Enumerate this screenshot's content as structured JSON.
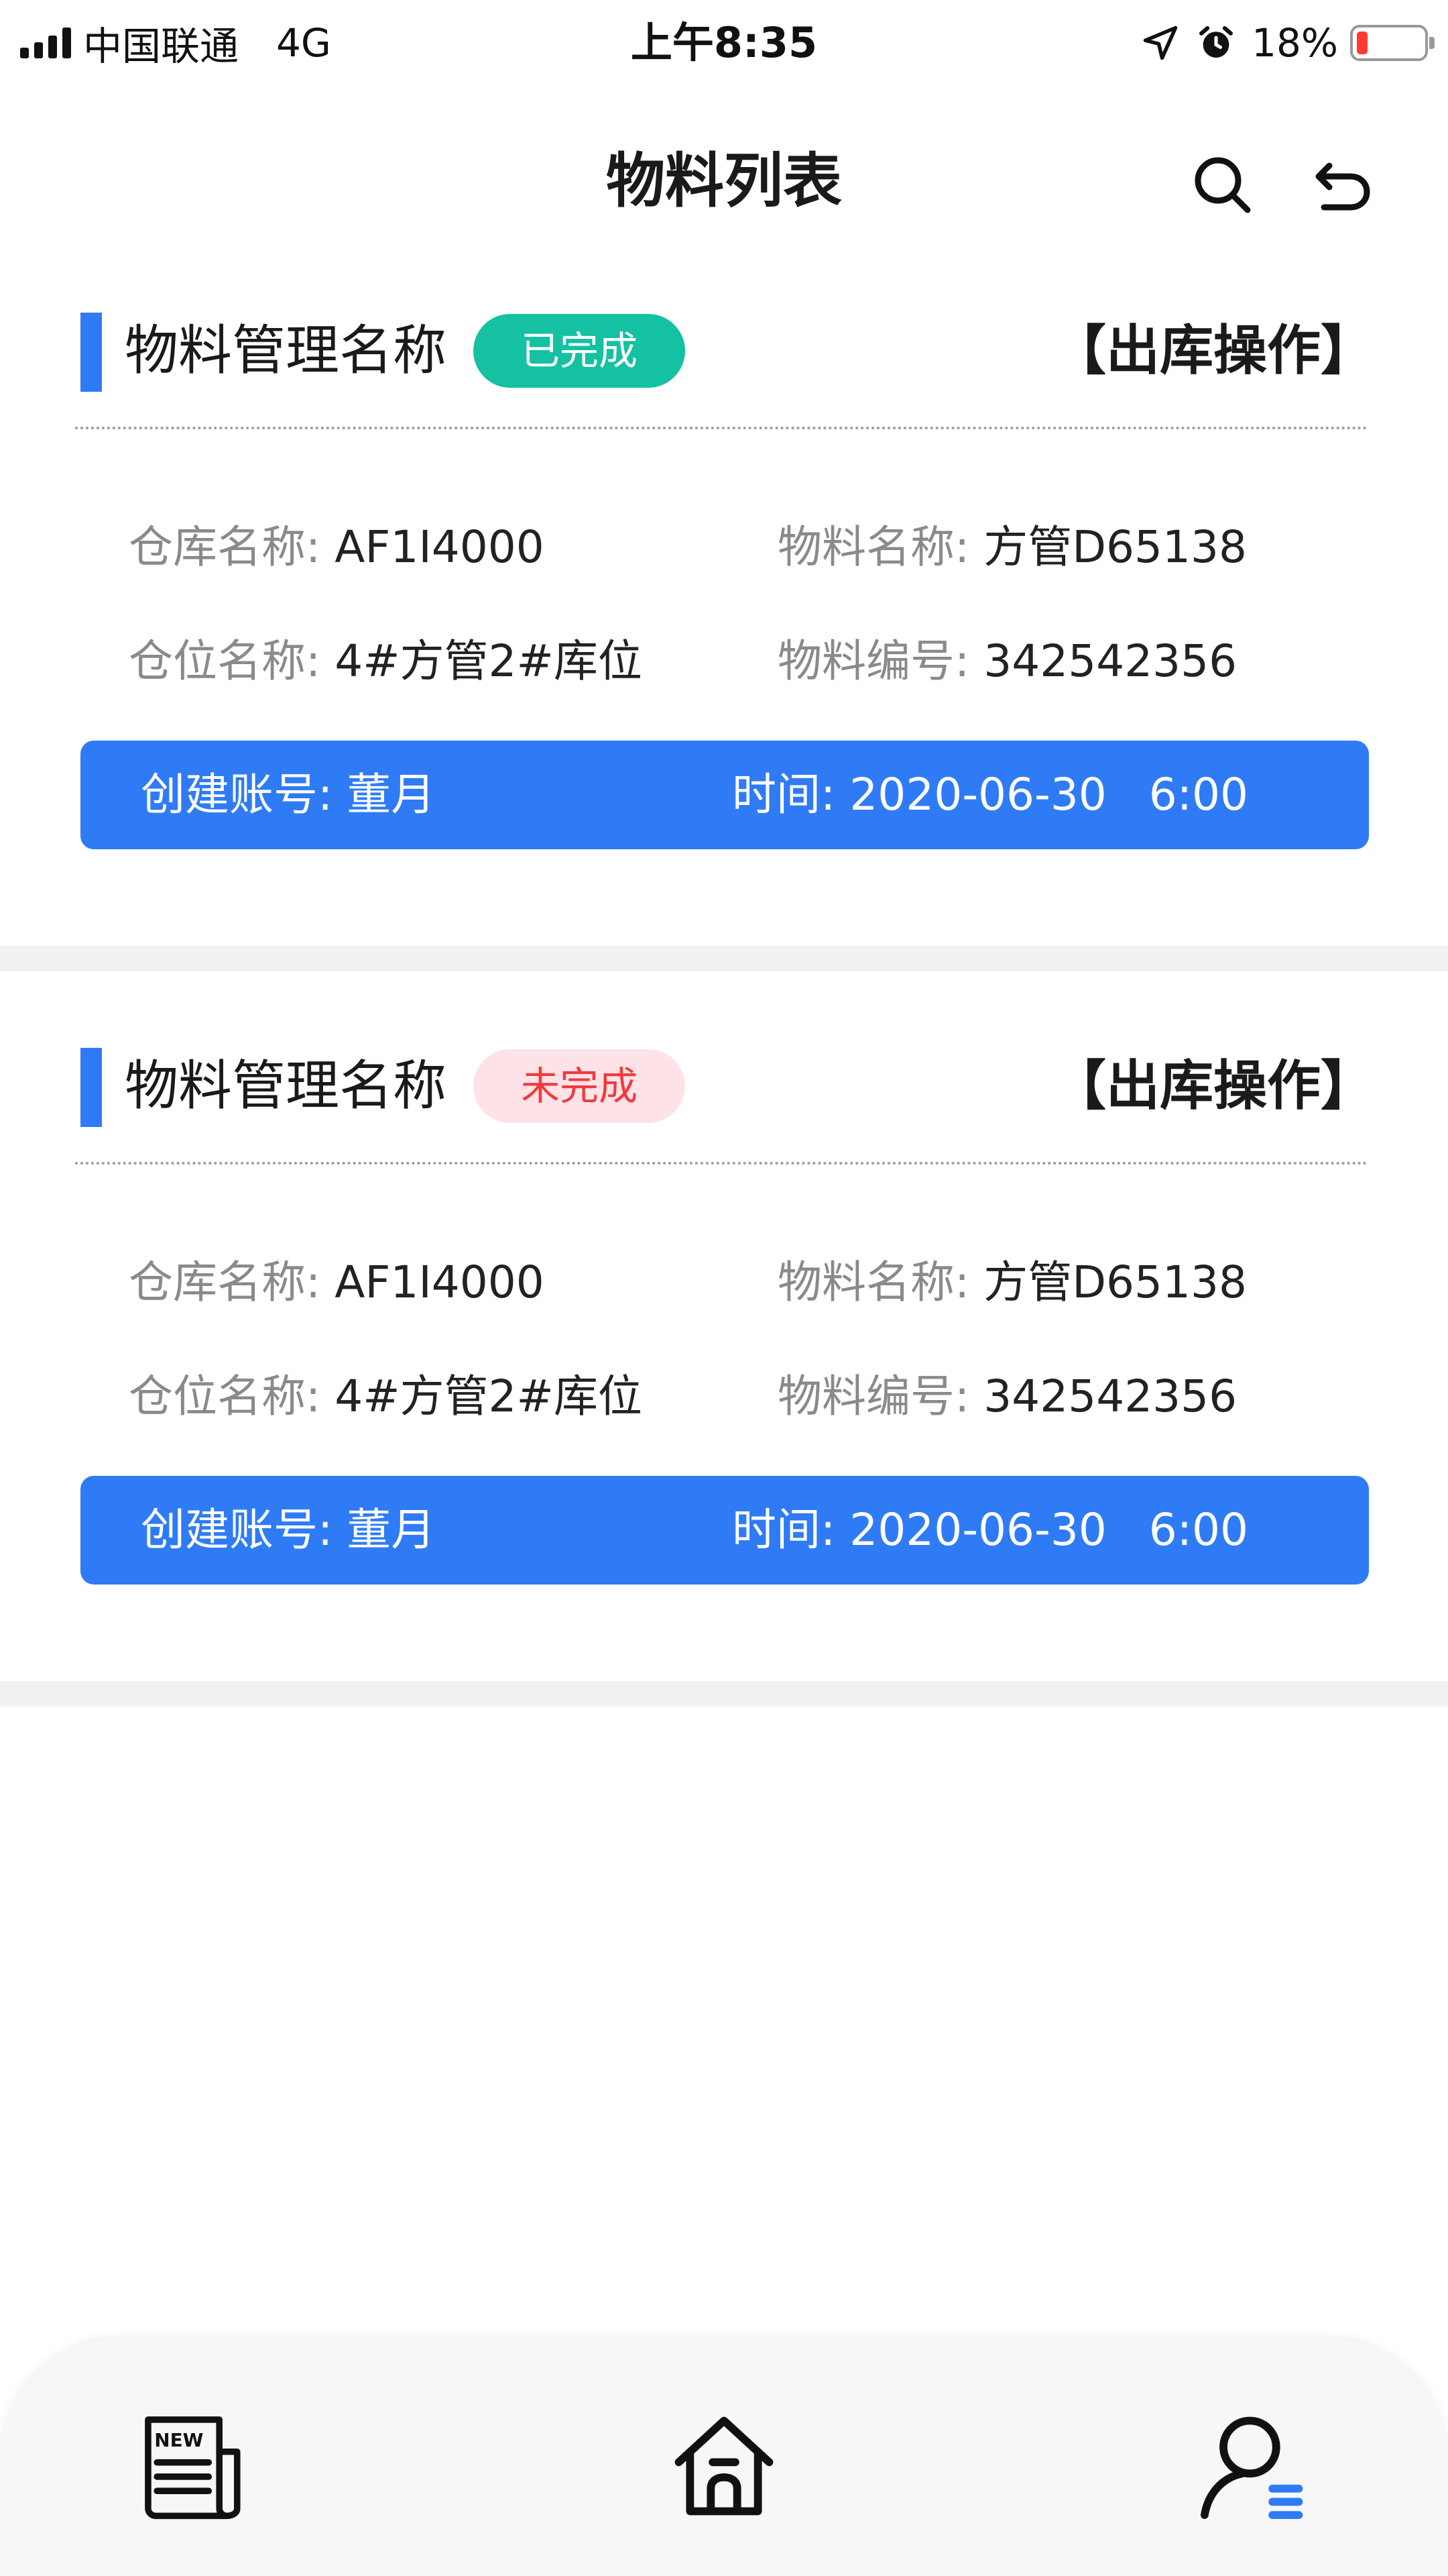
{
  "status_bar": {
    "carrier": "中国联通",
    "network": "4G",
    "time": "上午8:35",
    "battery_percent": "18%",
    "battery_level": 0.18,
    "battery_color": "#ff3b30"
  },
  "nav": {
    "title": "物料列表",
    "search_icon": "search-icon",
    "back_icon": "back-arrow-icon"
  },
  "colors": {
    "accent": "#2f7bf6",
    "done_badge": "#14c1a2",
    "pending_badge_bg": "#fde3e8",
    "pending_badge_text": "#f23a3a",
    "separator": "#f1f1f1"
  },
  "cards": [
    {
      "title": "物料管理名称",
      "status": "已完成",
      "action": "【出库操作】",
      "warehouse_label": "仓库名称:",
      "warehouse_value": "AF1I4000",
      "material_name_label": "物料名称:",
      "material_name_value": "方管D65138",
      "location_label": "仓位名称:",
      "location_value": "4#方管2#库位",
      "material_code_label": "物料编号:",
      "material_code_value": "342542356",
      "creator_label": "创建账号:",
      "creator_value": "董月",
      "time_label": "时间:",
      "time_value": "2020-06-30   6:00"
    },
    {
      "title": "物料管理名称",
      "status": "未完成",
      "action": "【出库操作】",
      "warehouse_label": "仓库名称:",
      "warehouse_value": "AF1I4000",
      "material_name_label": "物料名称:",
      "material_name_value": "方管D65138",
      "location_label": "仓位名称:",
      "location_value": "4#方管2#库位",
      "material_code_label": "物料编号:",
      "material_code_value": "342542356",
      "creator_label": "创建账号:",
      "creator_value": "董月",
      "time_label": "时间:",
      "time_value": "2020-06-30   6:00"
    }
  ],
  "tabs": [
    {
      "icon": "news-icon",
      "label": "NEW"
    },
    {
      "icon": "home-icon"
    },
    {
      "icon": "user-menu-icon"
    }
  ]
}
